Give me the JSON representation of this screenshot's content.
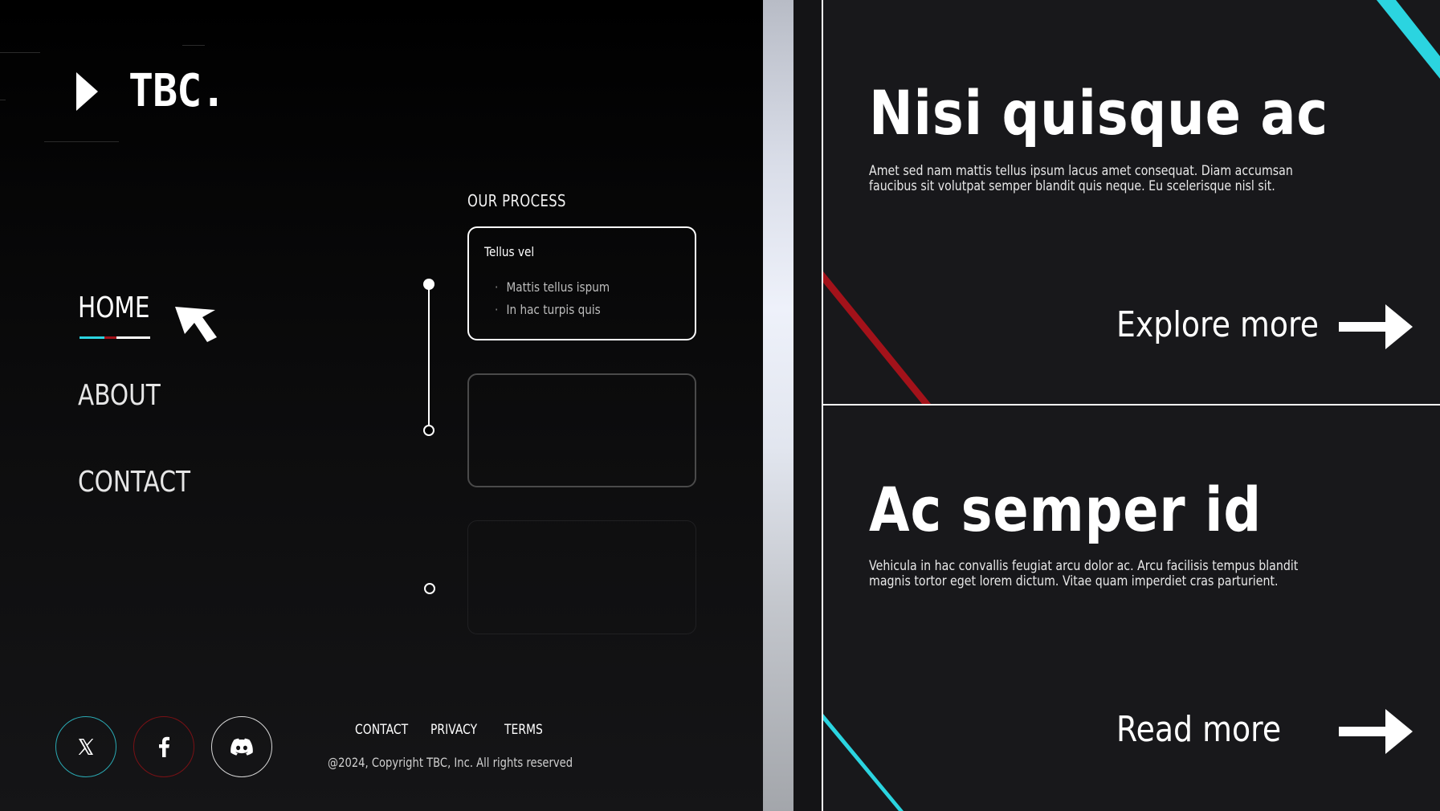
{
  "brand": {
    "logo_text": "TBC."
  },
  "nav": {
    "items": [
      {
        "label": "HOME",
        "active": true
      },
      {
        "label": "ABOUT",
        "active": false
      },
      {
        "label": "CONTACT",
        "active": false
      }
    ]
  },
  "process": {
    "title": "OUR PROCESS",
    "cards": [
      {
        "title": "Tellus vel",
        "items": [
          "Mattis tellus ispum",
          "In hac turpis quis"
        ]
      },
      {
        "title": "",
        "items": []
      },
      {
        "title": "",
        "items": []
      }
    ]
  },
  "social": [
    {
      "name": "x",
      "icon": "x-logo-icon",
      "ring_color": "#2aaab4"
    },
    {
      "name": "facebook",
      "icon": "facebook-icon",
      "ring_color": "#7a1115"
    },
    {
      "name": "discord",
      "icon": "discord-icon",
      "ring_color": "#d8d8d8"
    }
  ],
  "footer": {
    "links": [
      "CONTACT",
      "PRIVACY",
      "TERMS"
    ],
    "copyright": "@2024, Copyright TBC, Inc. All rights reserved"
  },
  "panels": [
    {
      "title": "Nisi quisque ac",
      "body": "Amet sed nam mattis tellus ipsum lacus amet consequat. Diam accumsan faucibus sit volutpat semper blandit quis neque. Eu scelerisque nisl sit.",
      "cta": "Explore more"
    },
    {
      "title": "Ac semper id",
      "body": "Vehicula in hac convallis feugiat arcu dolor ac. Arcu facilisis tempus blandit magnis tortor eget lorem dictum. Vitae quam imperdiet cras parturient.",
      "cta": "Read more"
    }
  ],
  "colors": {
    "accent_cyan": "#2bd4e0",
    "accent_red": "#a3121a",
    "panel_bg": "#18181b",
    "left_bg": "#000000"
  }
}
